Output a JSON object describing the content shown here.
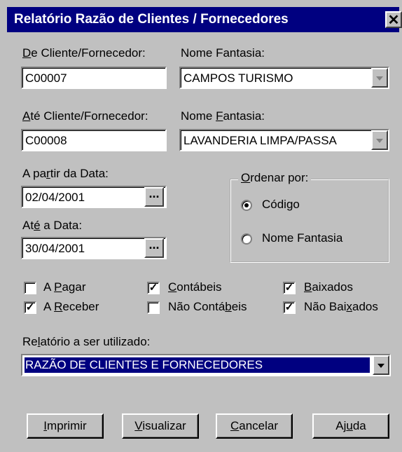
{
  "window": {
    "title": "Relatório Razão de Clientes / Fornecedores",
    "close_glyph": "✕"
  },
  "from": {
    "label_mnemonic": "D",
    "label_rest": "e Cliente/Fornecedor:",
    "code": "C00007",
    "name_label": "Nome Fantasia:",
    "name_value": "CAMPOS TURISMO"
  },
  "to": {
    "label_mnemonic": "A",
    "label_rest": "té Cliente/Fornecedor:",
    "code": "C00008",
    "name_label_pre": "Nome ",
    "name_label_mnemonic": "F",
    "name_label_post": "antasia:",
    "name_value": "LAVANDERIA LIMPA/PASSA"
  },
  "dates": {
    "start_label_pre": "A pa",
    "start_label_mnemonic": "r",
    "start_label_post": "tir da Data:",
    "start_value": "02/04/2001",
    "end_label_pre": "At",
    "end_label_mnemonic": "é",
    "end_label_post": " a Data:",
    "end_value": "30/04/2001",
    "button_glyph": "..."
  },
  "order": {
    "title_mnemonic": "O",
    "title_rest": "rdenar por:",
    "options": [
      {
        "label": "Código",
        "selected": true
      },
      {
        "label": "Nome Fantasia",
        "selected": false
      }
    ]
  },
  "filters": {
    "a_pagar": {
      "pre": "A ",
      "m": "P",
      "post": "agar",
      "checked": false
    },
    "a_receber": {
      "pre": "A ",
      "m": "R",
      "post": "eceber",
      "checked": true
    },
    "contabeis": {
      "pre": "",
      "m": "C",
      "post": "ontábeis",
      "checked": true
    },
    "nao_contabeis": {
      "pre": "Não Contá",
      "m": "b",
      "post": "eis",
      "checked": false
    },
    "baixados": {
      "pre": "",
      "m": "B",
      "post": "aixados",
      "checked": true
    },
    "nao_baixados": {
      "pre": "Não Bai",
      "m": "x",
      "post": "ados",
      "checked": true
    },
    "check_glyph": "✓"
  },
  "report": {
    "label_pre": "Re",
    "label_mnemonic": "l",
    "label_post": "atório a ser utilizado:",
    "value": "RAZÃO DE CLIENTES E FORNECEDORES"
  },
  "buttons": {
    "print": {
      "m": "I",
      "post": "mprimir"
    },
    "preview": {
      "m": "V",
      "post": "isualizar"
    },
    "cancel": {
      "m": "C",
      "post": "ancelar"
    },
    "help": {
      "pre": "Aj",
      "m": "u",
      "post": "da"
    }
  }
}
